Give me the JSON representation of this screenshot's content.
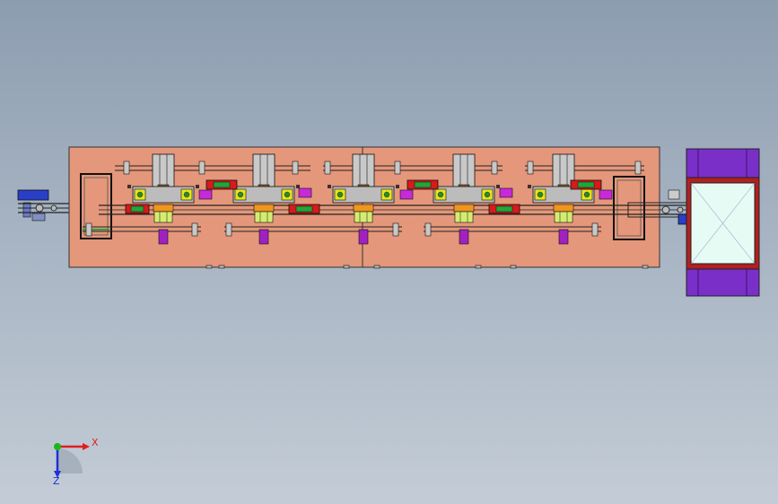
{
  "viewport": {
    "background_top": "#8d9db0",
    "background_bottom": "#c3ccd6"
  },
  "machine": {
    "base_plate_color": "#e4977a",
    "station_count": 5,
    "cylinder_color": "#a020c0",
    "frame_color": "#7a2fc8",
    "tray_color": "#e6fbf4",
    "motor_color": "#2a3fc8",
    "valve_red": "#d81a1a",
    "valve_green": "#1ea83a",
    "sensor_yellow": "#e8e41a",
    "fitting_orange": "#f0961e"
  },
  "triad": {
    "x_label": "X",
    "z_label": "Z",
    "x_color": "#e01e1e",
    "y_color": "#18b818",
    "z_color": "#2030d8"
  }
}
